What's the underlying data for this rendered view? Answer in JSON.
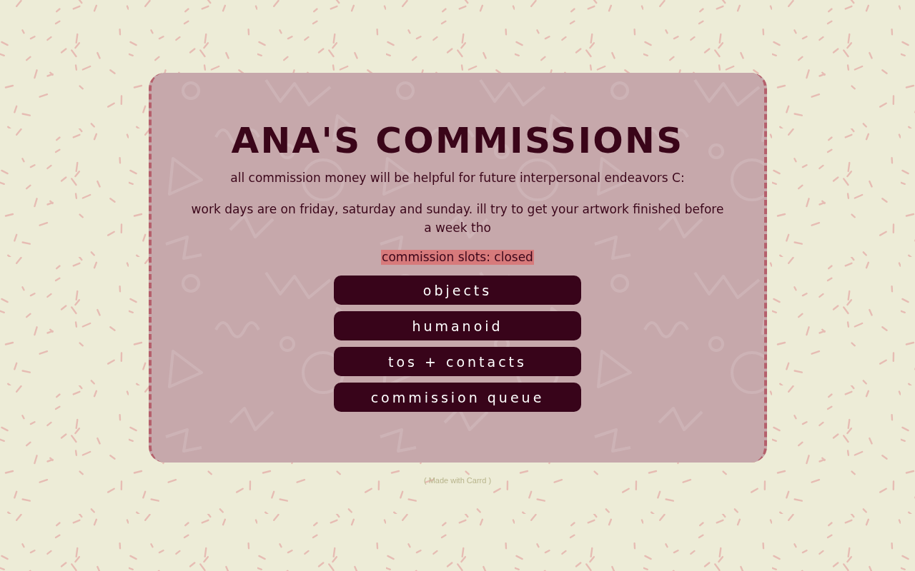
{
  "card": {
    "title": "ANA'S COMMISSIONS",
    "paragraphs": [
      "all commission money will be helpful for future interpersonal endeavors C:",
      "work days are on friday, saturday and sunday. ill try to get your artwork finished before a week tho"
    ],
    "status": "commission slots: closed",
    "buttons": [
      "objects",
      "humanoid",
      "tos + contacts",
      "commission queue"
    ]
  },
  "footer": {
    "text": "( Made with Carrd )"
  }
}
